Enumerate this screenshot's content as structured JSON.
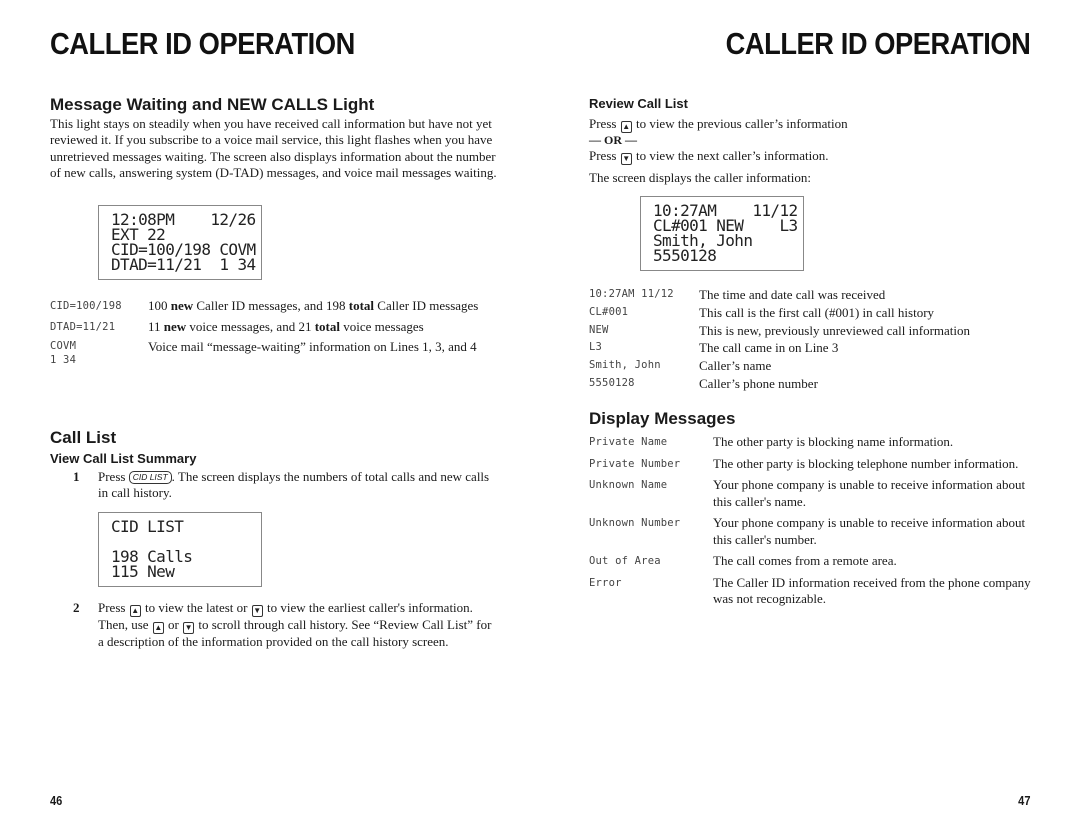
{
  "left_page": {
    "title": "CALLER ID OPERATION",
    "page_number": "46",
    "message_waiting": {
      "heading": "Message Waiting and NEW CALLS Light",
      "paragraph": "This light stays on steadily when you have received call information but have not yet reviewed it.  If you subscribe to a voice mail service, this light flashes when you have unretrieved messages waiting. The screen also displays information about the number of new calls, answering system (D-TAD) messages, and voice mail messages waiting.",
      "lcd": [
        "12:08PM    12/26",
        "EXT 22",
        "CID=100/198 COVM",
        "DTAD=11/21  1 34"
      ],
      "legend": [
        {
          "key": "CID=100/198",
          "pre": "100  ",
          "b1": "new",
          "mid": " Caller ID messages, and 198 ",
          "b2": "total",
          "post": " Caller ID messages"
        },
        {
          "key": "DTAD=11/21",
          "pre": "11 ",
          "b1": "new",
          "mid": " voice messages, and 21 ",
          "b2": "total",
          "post": " voice messages"
        },
        {
          "key": "COVM\n1 34",
          "pre": "Voice mail “message-waiting” information on Lines 1, 3, and 4",
          "b1": "",
          "mid": "",
          "b2": "",
          "post": ""
        }
      ]
    },
    "call_list": {
      "heading": "Call List",
      "subheading": "View Call List Summary",
      "step1": {
        "number": "1",
        "press": "Press ",
        "key_label": "CID LIST",
        "text": ". The screen displays the numbers of total calls and new calls in call history."
      },
      "lcd": [
        "CID LIST",
        "",
        "198 Calls",
        "115 New"
      ],
      "step2": {
        "number": "2",
        "t1": "Press ",
        "t2": " to view the latest or ",
        "t3": " to view the earliest caller's information. Then, use ",
        "t4": " or ",
        "t5": " to scroll through call history.  See “Review Call List” for a description of the information provided on the call history screen."
      }
    }
  },
  "right_page": {
    "title": "CALLER ID OPERATION",
    "page_number": "47",
    "review": {
      "heading": "Review Call List",
      "line1_pre": "Press ",
      "line1_post": " to view the previous caller’s information",
      "or": "— OR —",
      "line2_pre": "Press ",
      "line2_post": " to view the next caller’s information.",
      "screen_intro": "The screen displays the caller information:",
      "lcd": [
        "10:27AM    11/12",
        "CL#001 NEW    L3",
        "Smith, John",
        "5550128"
      ],
      "legend": [
        {
          "key": "10:27AM 11/12",
          "value": "The time and date call was received"
        },
        {
          "key": "CL#001",
          "value": "This call is the first call (#001) in call history"
        },
        {
          "key": "NEW",
          "value": "This is new, previously unreviewed call information"
        },
        {
          "key": "L3",
          "value": "The call came in on Line 3"
        },
        {
          "key": "Smith, John",
          "value": "Caller’s name"
        },
        {
          "key": "5550128",
          "value": "Caller’s phone number"
        }
      ]
    },
    "display_messages": {
      "heading": "Display Messages",
      "items": [
        {
          "key": "Private Name",
          "value": "The other party is blocking name information."
        },
        {
          "key": "Private Number",
          "value": "The other party is blocking telephone number information."
        },
        {
          "key": "Unknown Name",
          "value": "Your phone company is unable to receive information about this caller's name."
        },
        {
          "key": "Unknown Number",
          "value": "Your phone company is unable to receive information about this caller's number."
        },
        {
          "key": "Out of Area",
          "value": "The call comes from a remote area."
        },
        {
          "key": "Error",
          "value": "The Caller ID information received from the phone company was not recognizable."
        }
      ]
    }
  },
  "icons": {
    "up": "▲",
    "down": "▼"
  }
}
